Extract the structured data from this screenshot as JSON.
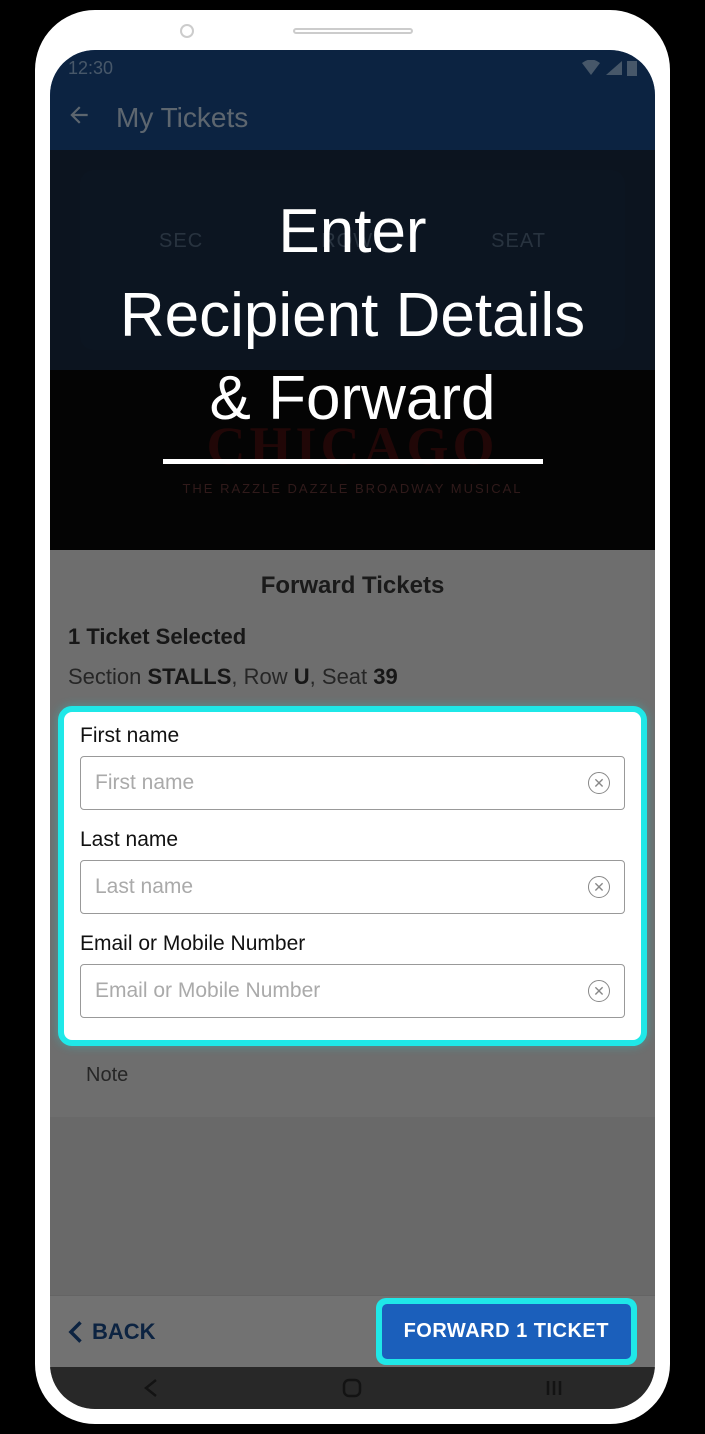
{
  "status": {
    "time": "12:30"
  },
  "appbar": {
    "title": "My Tickets"
  },
  "hero": {
    "labels": {
      "sec": "SEC",
      "row": "ROW",
      "seat": "SEAT"
    },
    "show_title": "CHICAGO",
    "show_subtitle": "THE RAZZLE DAZZLE BROADWAY MUSICAL"
  },
  "panel": {
    "title": "Forward Tickets",
    "selected": "1 Ticket Selected",
    "seat_prefix_section": "Section ",
    "seat_section": "STALLS",
    "seat_row_prefix": ", Row ",
    "seat_row": "U",
    "seat_seat_prefix": ", Seat ",
    "seat_seat": "39"
  },
  "form": {
    "first_label": "First name",
    "first_placeholder": "First name",
    "last_label": "Last name",
    "last_placeholder": "Last name",
    "contact_label": "Email or Mobile Number",
    "contact_placeholder": "Email or Mobile Number"
  },
  "note_label": "Note",
  "bottom": {
    "back": "BACK",
    "forward": "FORWARD 1 TICKET"
  },
  "overlay": {
    "line1": "Enter",
    "line2": "Recipient Details",
    "line3": "& Forward"
  }
}
